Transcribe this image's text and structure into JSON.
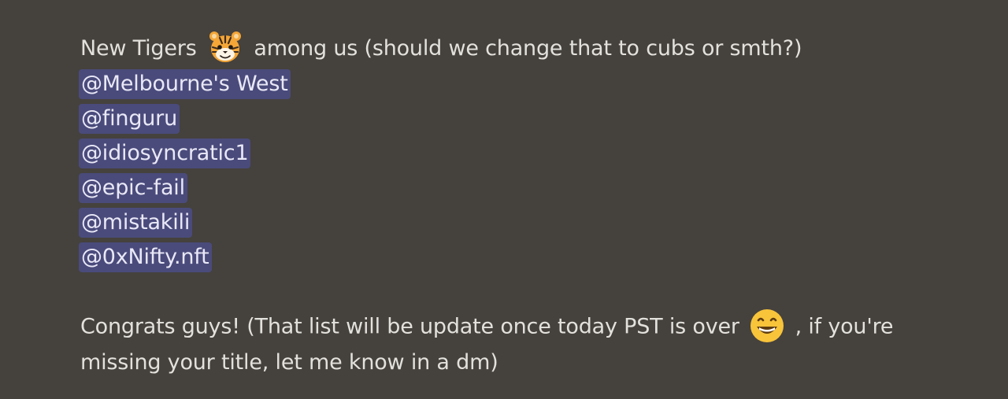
{
  "message": {
    "intro_before": "New Tigers",
    "intro_emoji": "tiger-face-icon",
    "intro_after": "among us (should we change that to cubs or smth?)",
    "mentions": [
      "@Melbourne's West",
      "@finguru",
      "@idiosyncratic1",
      "@epic-fail",
      "@mistakili",
      "@0xNifty.nft"
    ],
    "congrats_before": "Congrats guys! (That list will be update once today PST is over",
    "congrats_emoji": "grinning-face-icon",
    "congrats_after": ", if you're missing your title, let me know in a dm)"
  },
  "colors": {
    "background": "#45413d",
    "text": "#e3e1dc",
    "mention_background": "#4a4b7b",
    "mention_text": "#e9e8f7"
  }
}
